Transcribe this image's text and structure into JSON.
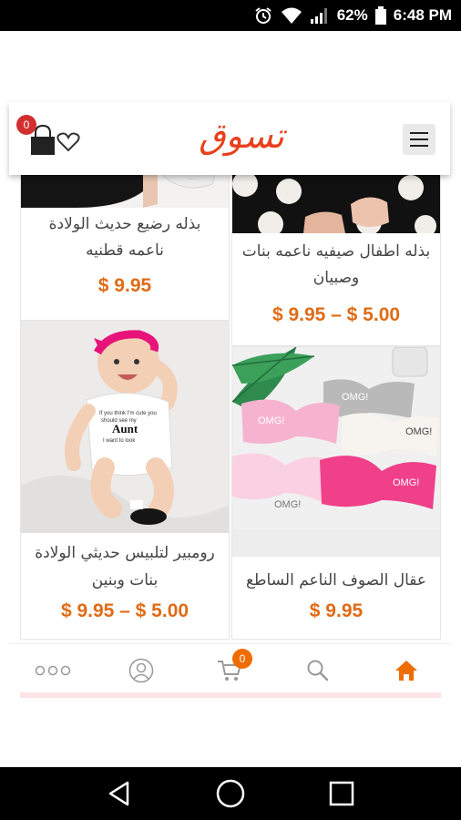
{
  "status_bar": {
    "battery_percent": "62%",
    "time": "6:48 PM"
  },
  "header": {
    "logo_text": "تسوق",
    "cart_count": "0",
    "brand_color": "#e8401c"
  },
  "products": [
    {
      "title_line1": "بذله رضيع حديث الولادة",
      "title_line2": "ناعمه قطنيه",
      "price": "$ 9.95"
    },
    {
      "title_line1": "بذله اطفال صيفيه ناعمه بنات",
      "title_line2": "وصبيان",
      "price": "$ 9.95 – $ 5.00"
    },
    {
      "title_line1": "رومبير لتلبيس حديثي الولادة",
      "title_line2": "بنات وبنين",
      "price": "$ 9.95 – $ 5.00",
      "image_text": "Aunt"
    },
    {
      "title_line1": "عقال الصوف الناعم الساطع",
      "title_line2": "",
      "price": "$ 9.95",
      "image_text": "OMG!"
    }
  ],
  "bottom_nav": {
    "items": [
      {
        "icon": "more-dots-icon"
      },
      {
        "icon": "user-icon"
      },
      {
        "icon": "cart-icon",
        "badge": "0"
      },
      {
        "icon": "search-icon"
      },
      {
        "icon": "home-icon",
        "active": true
      }
    ],
    "active_color": "#ef6c00"
  },
  "colors": {
    "price": "#e06b16",
    "badge_red": "#d32f2f"
  }
}
